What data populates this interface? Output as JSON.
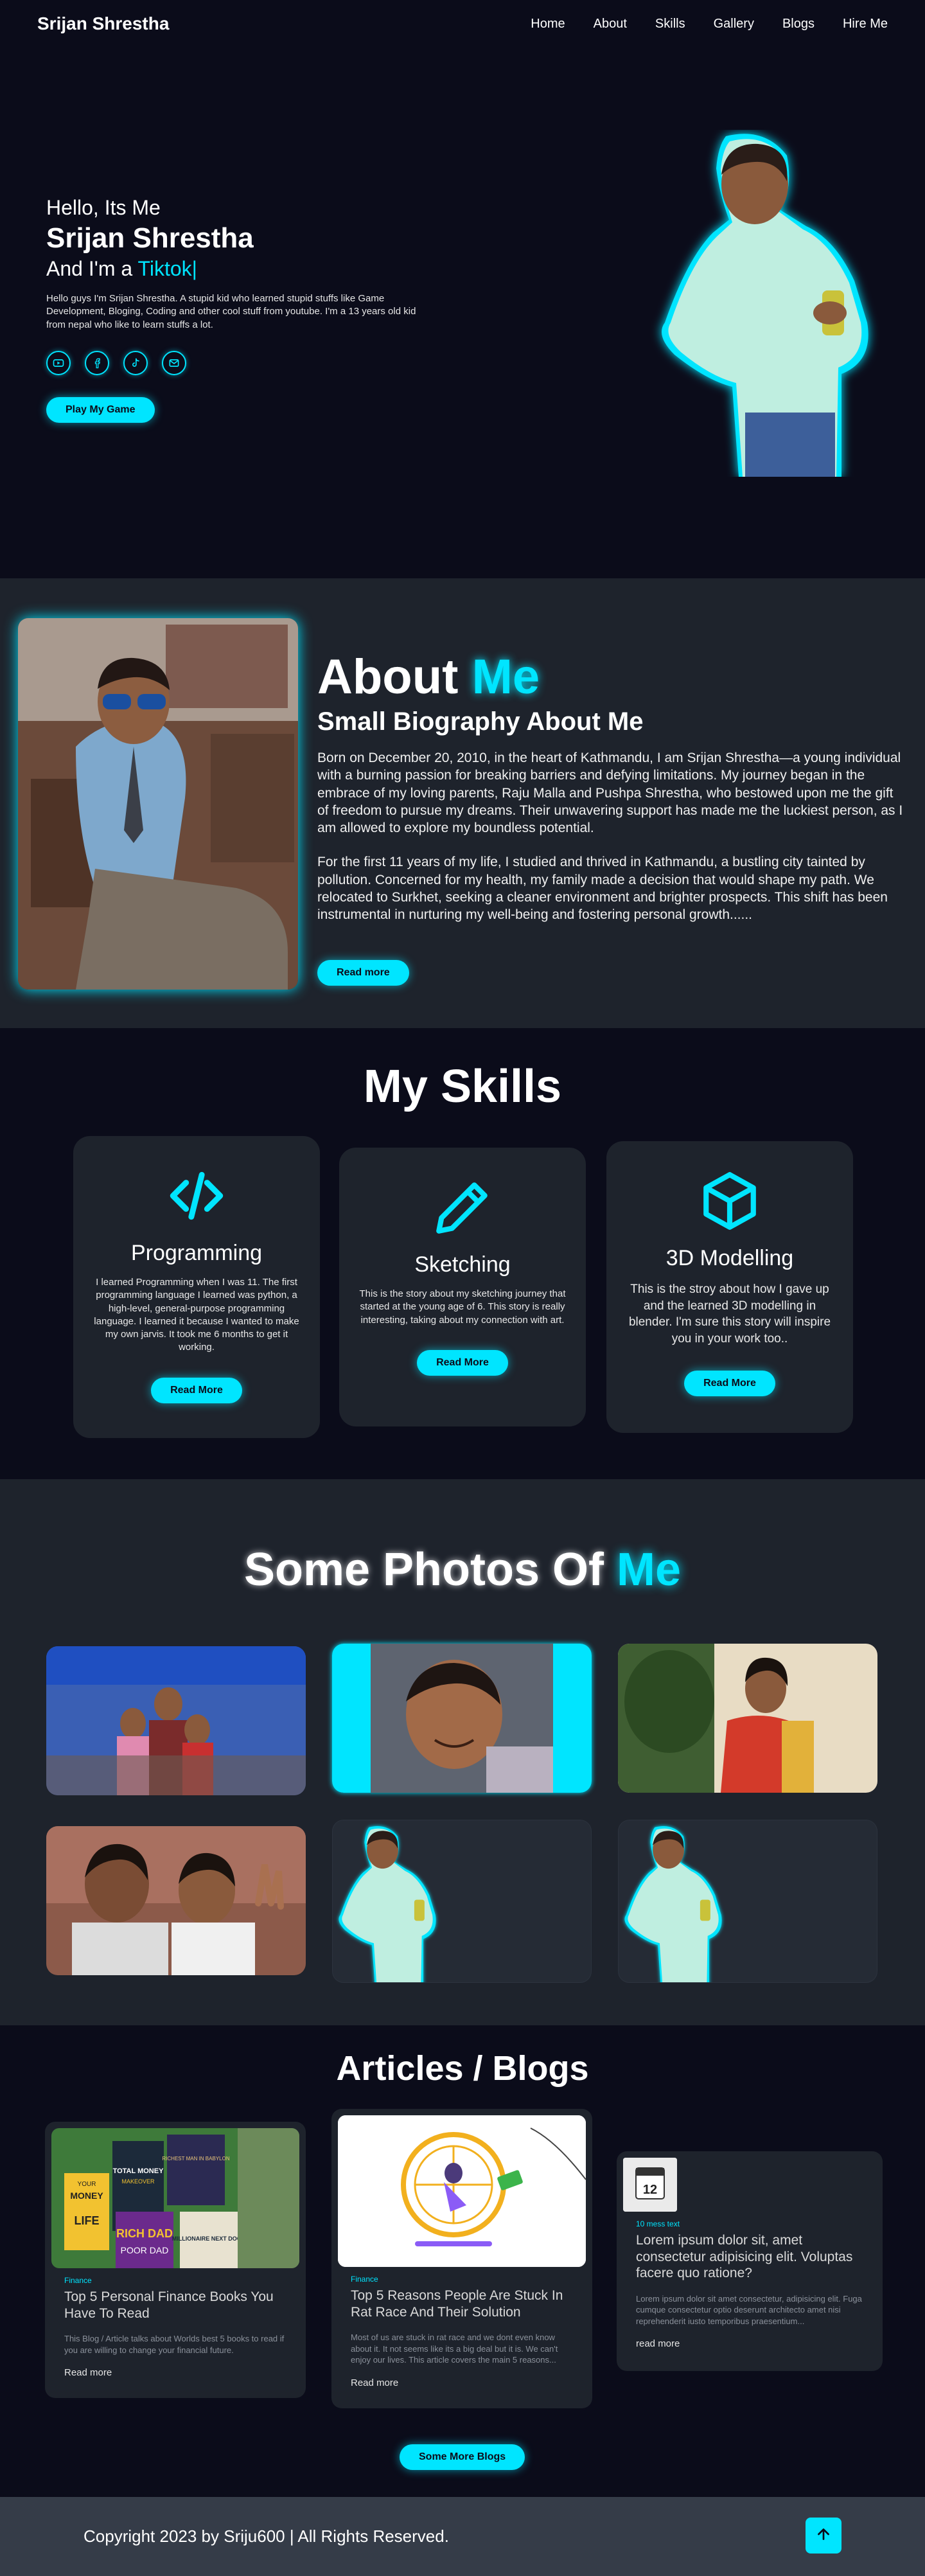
{
  "nav": {
    "logo": "Srijan Shrestha",
    "items": [
      "Home",
      "About",
      "Skills",
      "Gallery",
      "Blogs",
      "Hire Me"
    ]
  },
  "hero": {
    "greeting": "Hello, Its Me",
    "name": "Srijan Shrestha",
    "role_prefix": "And I'm a ",
    "role_word": "Tiktok",
    "role_caret": "|",
    "description": "Hello guys I'm Srijan Shrestha. A stupid kid who learned stupid stuffs like Game Development, Bloging, Coding and other cool stuff from youtube. I'm a 13 years old kid from nepal who like to learn stuffs a lot.",
    "socials": [
      "youtube-icon",
      "facebook-icon",
      "tiktok-icon",
      "email-icon"
    ],
    "button": "Play My Game"
  },
  "about": {
    "title_a": "About",
    "title_b": "Me",
    "subtitle": "Small Biography About Me",
    "paragraph_1": "Born on December 20, 2010, in the heart of Kathmandu, I am Srijan Shrestha—a young individual with a burning passion for breaking barriers and defying limitations. My journey began in the embrace of my loving parents, Raju Malla and Pushpa Shrestha, who bestowed upon me the gift of freedom to pursue my dreams. Their unwavering support has made me the luckiest person, as I am allowed to explore my boundless potential.",
    "paragraph_2": "For the first 11 years of my life, I studied and thrived in Kathmandu, a bustling city tainted by pollution. Concerned for my health, my family made a decision that would shape my path. We relocated to Surkhet, seeking a cleaner environment and brighter prospects. This shift has been instrumental in nurturing my well-being and fostering personal growth......",
    "button": "Read more"
  },
  "skills": {
    "title": "My Skills",
    "cards": [
      {
        "icon": "code-icon",
        "title": "Programming",
        "text": "I learned Programming when I was 11. The first programming language I learned was python, a high-level, general-purpose programming language. I learned it because I wanted to make my own jarvis. It took me 6 months to get it working.",
        "button": "Read More"
      },
      {
        "icon": "pencil-icon",
        "title": "Sketching",
        "text": "This is the story about my sketching journey that started at the young age of 6. This story is really interesting, taking about my connection with art.",
        "button": "Read More"
      },
      {
        "icon": "cube-icon",
        "title": "3D Modelling",
        "text": "This is the stroy about how I gave up and the learned 3D modelling in blender. I'm sure this story will inspire you in your work too..",
        "button": "Read More"
      }
    ]
  },
  "gallery": {
    "title_a": "Some Photos Of",
    "title_b": "Me"
  },
  "blogs": {
    "title": "Articles / Blogs",
    "cards": [
      {
        "category": "Finance",
        "title": "Top 5 Personal Finance Books You Have To Read",
        "excerpt": "This Blog / Article talks about Worlds best 5 books to read if you are willing to change your financial future.",
        "read": "Read more"
      },
      {
        "category": "Finance",
        "title": "Top 5 Reasons People Are Stuck In Rat Race And Their Solution",
        "excerpt": "Most of us are stuck in rat race and we dont even know about it. It not seems like its a big deal but it is. We can't enjoy our lives. This article covers the main 5 reasons...",
        "read": "Read more"
      },
      {
        "category": "10 mess text",
        "title": "Lorem ipsum dolor sit, amet consectetur adipisicing elit. Voluptas facere quo ratione?",
        "excerpt": "Lorem ipsum dolor sit amet consectetur, adipisicing elit. Fuga cumque consectetur optio deserunt architecto amet nisi reprehenderit iusto temporibus praesentium...",
        "read": "read more"
      }
    ],
    "more_button": "Some More Blogs"
  },
  "book_covers": {
    "b1": "MONEY",
    "b1b": "YOUR",
    "b1c": "LIFE",
    "b2": "TOTAL MONEY",
    "b2b": "MAKEOVER",
    "b3": "RICHEST MAN IN BABYLON",
    "b4": "RICH DAD",
    "b4b": "POOR DAD",
    "b5": "MILLIONAIRE NEXT DOOR"
  },
  "calendar_badge": "12",
  "footer": {
    "copyright": "Copyright 2023 by Sriju600 | All Rights Reserved.",
    "top_icon": "arrow-up-icon"
  },
  "colors": {
    "accent": "#00e5ff",
    "background_dark": "#0b0c1a",
    "background_panel": "#1e232c",
    "footer": "#353c48"
  }
}
